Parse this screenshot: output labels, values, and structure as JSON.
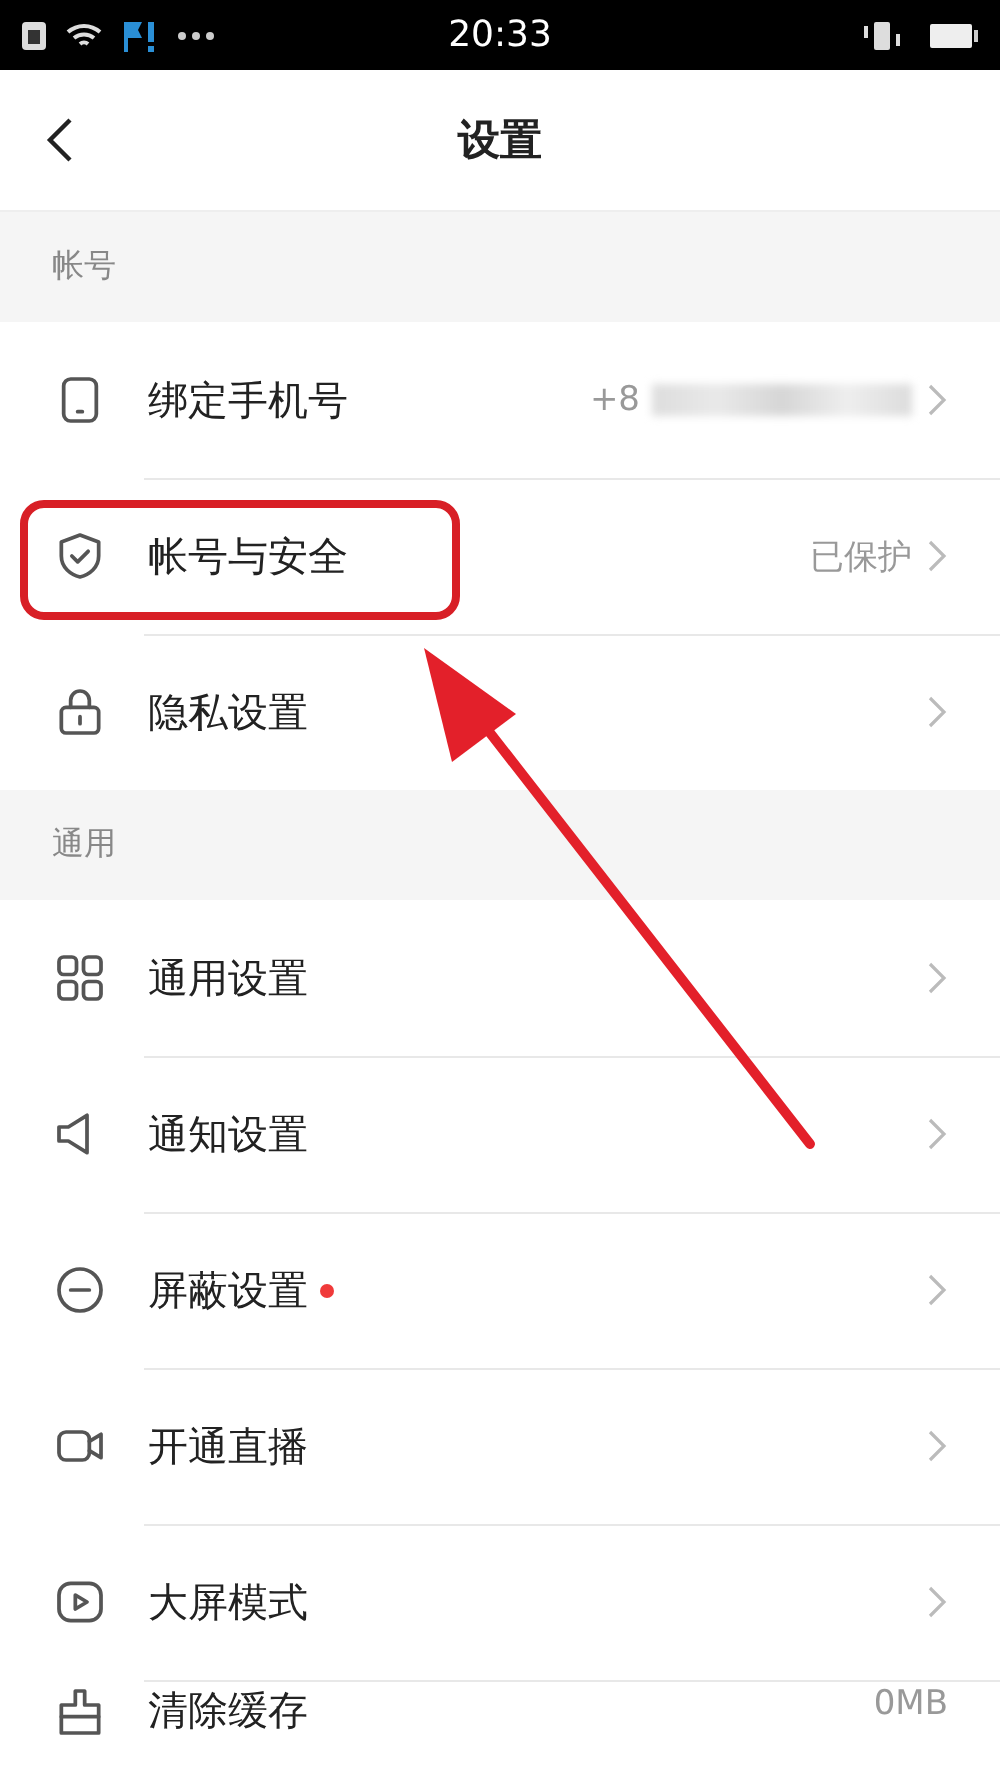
{
  "status_bar": {
    "time": "20:33"
  },
  "header": {
    "title": "设置"
  },
  "sections": [
    {
      "title": "帐号",
      "rows": [
        {
          "kind": "phone",
          "label": "绑定手机号",
          "value": "+8",
          "redacted": true,
          "badge": false,
          "highlighted": false,
          "chevron": true
        },
        {
          "kind": "shield",
          "label": "帐号与安全",
          "value": "已保护",
          "redacted": false,
          "badge": false,
          "highlighted": true,
          "chevron": true
        },
        {
          "kind": "lock",
          "label": "隐私设置",
          "redacted": false,
          "badge": false,
          "highlighted": false,
          "chevron": true
        }
      ]
    },
    {
      "title": "通用",
      "rows": [
        {
          "kind": "grid",
          "label": "通用设置",
          "redacted": false,
          "badge": false,
          "highlighted": false,
          "chevron": true
        },
        {
          "kind": "speaker",
          "label": "通知设置",
          "redacted": false,
          "badge": false,
          "highlighted": false,
          "chevron": true
        },
        {
          "kind": "minus",
          "label": "屏蔽设置",
          "redacted": false,
          "badge": true,
          "highlighted": false,
          "chevron": true
        },
        {
          "kind": "camera",
          "label": "开通直播",
          "redacted": false,
          "badge": false,
          "highlighted": false,
          "chevron": true
        },
        {
          "kind": "play",
          "label": "大屏模式",
          "redacted": false,
          "badge": false,
          "highlighted": false,
          "chevron": true
        },
        {
          "kind": "brush",
          "label": "清除缓存",
          "value": "0MB",
          "redacted": false,
          "badge": false,
          "highlighted": false,
          "chevron": false
        }
      ]
    }
  ],
  "annotation": {
    "kind": "arrow"
  }
}
